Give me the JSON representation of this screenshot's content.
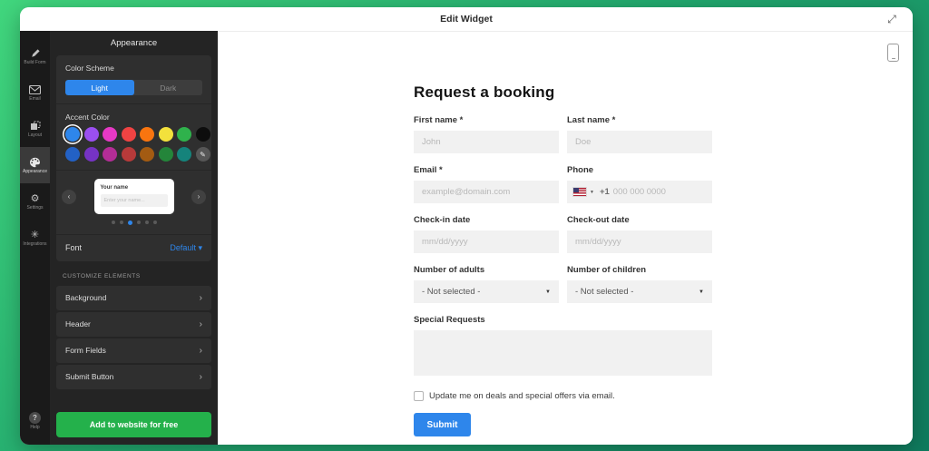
{
  "window": {
    "title": "Edit Widget"
  },
  "sidebar": {
    "items": [
      {
        "label": "Build Form",
        "icon": "pencil-icon"
      },
      {
        "label": "Email",
        "icon": "envelope-icon"
      },
      {
        "label": "Layout",
        "icon": "layout-icon"
      },
      {
        "label": "Appearance",
        "icon": "palette-icon",
        "active": true
      },
      {
        "label": "Settings",
        "icon": "gear-icon"
      },
      {
        "label": "Integrations",
        "icon": "asterisk-icon"
      }
    ],
    "help_label": "Help"
  },
  "panel": {
    "title": "Appearance",
    "color_scheme": {
      "label": "Color Scheme",
      "light": "Light",
      "dark": "Dark",
      "selected": "Light"
    },
    "accent": {
      "label": "Accent Color",
      "row1": [
        "#2e86eb",
        "#9b4ff0",
        "#e639c5",
        "#f04343",
        "#f9750f",
        "#f3e13c",
        "#2fb24c",
        "#0d0d0d"
      ],
      "row2": [
        "#2361c4",
        "#7633c4",
        "#b32d96",
        "#b73a3a",
        "#a35b12",
        "#24853a",
        "#15837b"
      ],
      "selected_row": 0,
      "selected_index": 0,
      "eyedropper_icon": "✎"
    },
    "preview": {
      "card_label": "Your name",
      "card_placeholder": "Enter your name...",
      "dot_count": 6,
      "active_dot": 2,
      "prev_icon": "‹",
      "next_icon": "›"
    },
    "font": {
      "label": "Font",
      "value": "Default",
      "caret": "▾"
    },
    "customize": {
      "heading": "CUSTOMIZE ELEMENTS",
      "items": [
        "Background",
        "Header",
        "Form Fields",
        "Submit Button"
      ],
      "chevron": "›"
    },
    "cta_label": "Add to website for free"
  },
  "form": {
    "title": "Request a booking",
    "first_name": {
      "label": "First name *",
      "placeholder": "John"
    },
    "last_name": {
      "label": "Last name *",
      "placeholder": "Doe"
    },
    "email": {
      "label": "Email *",
      "placeholder": "example@domain.com"
    },
    "phone": {
      "label": "Phone",
      "country_code": "+1",
      "placeholder": "000 000 0000",
      "caret": "▼"
    },
    "check_in": {
      "label": "Check-in date",
      "placeholder": "mm/dd/yyyy"
    },
    "check_out": {
      "label": "Check-out date",
      "placeholder": "mm/dd/yyyy"
    },
    "adults": {
      "label": "Number of adults",
      "value": "- Not selected -",
      "caret": "▼"
    },
    "children": {
      "label": "Number of children",
      "value": "- Not selected -",
      "caret": "▼"
    },
    "special_requests": {
      "label": "Special Requests"
    },
    "checkbox_label": "Update me on deals and special offers via email.",
    "submit_label": "Submit"
  },
  "icons": {
    "expand": "⤢",
    "help": "?"
  },
  "colors": {
    "accent_blue": "#2e86eb",
    "cta_green": "#24b14b"
  }
}
